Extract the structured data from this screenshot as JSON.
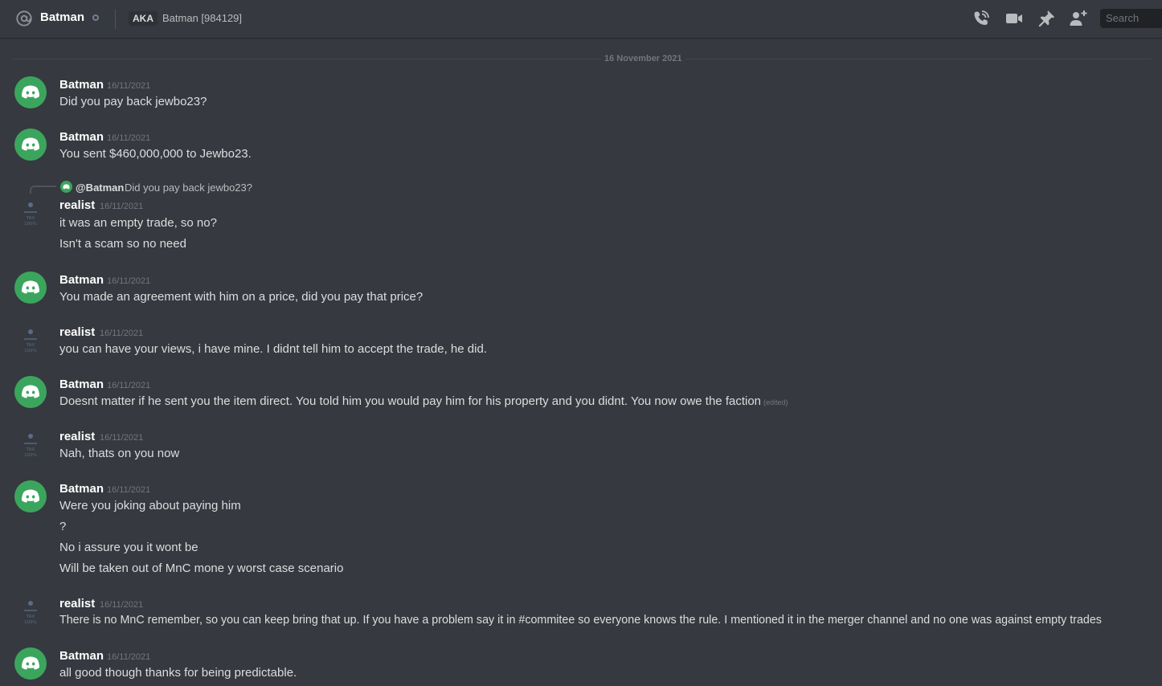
{
  "header": {
    "dm_name": "Batman",
    "aka_label": "AKA",
    "aka_names": "Batman [984129]",
    "search_placeholder": "Search",
    "icons": [
      "at-icon",
      "call-icon",
      "video-icon",
      "pin-icon",
      "add-friend-icon"
    ]
  },
  "date_separator": "16 November 2021",
  "colors": {
    "background": "#36393f",
    "discord_green": "#3ba55d",
    "text": "#dcddde",
    "muted": "#72767d"
  },
  "messages": [
    {
      "author": "Batman",
      "timestamp": "16/11/2021",
      "lines": [
        "Did you pay back jewbo23?"
      ]
    },
    {
      "author": "Batman",
      "timestamp": "16/11/2021",
      "lines": [
        "You sent $460,000,000 to Jewbo23."
      ]
    },
    {
      "author": "realist",
      "timestamp": "16/11/2021",
      "reply": {
        "name": "@Batman",
        "text": "Did you pay back jewbo23?"
      },
      "lines": [
        "it was an empty trade, so no?",
        "Isn't a scam so no need"
      ]
    },
    {
      "author": "Batman",
      "timestamp": "16/11/2021",
      "lines": [
        "You made an agreement with him on a price, did you pay that price?"
      ]
    },
    {
      "author": "realist",
      "timestamp": "16/11/2021",
      "lines": [
        "you can have your views, i have mine. I didnt tell him to accept the trade, he did."
      ]
    },
    {
      "author": "Batman",
      "timestamp": "16/11/2021",
      "lines": [
        "Doesnt matter if he sent you the item direct. You told him you would pay him for his property and you didnt. You now owe the faction"
      ],
      "edited": "(edited)"
    },
    {
      "author": "realist",
      "timestamp": "16/11/2021",
      "lines": [
        "Nah, thats on you now"
      ]
    },
    {
      "author": "Batman",
      "timestamp": "16/11/2021",
      "lines": [
        "Were you joking about paying him",
        "?",
        "No i assure you it wont be",
        "Will be taken out of MnC mone y worst case scenario"
      ]
    },
    {
      "author": "realist",
      "timestamp": "16/11/2021",
      "lines": [
        "There is no MnC remember, so you can keep bring that up. If you have a problem say it in #commitee so everyone knows the rule. I mentioned it in the merger channel and no one was against empty trades"
      ]
    },
    {
      "author": "Batman",
      "timestamp": "16/11/2021",
      "lines": [
        "all good though thanks for being predictable."
      ]
    }
  ],
  "tax_avatar_text": [
    "TAX",
    "100%"
  ]
}
